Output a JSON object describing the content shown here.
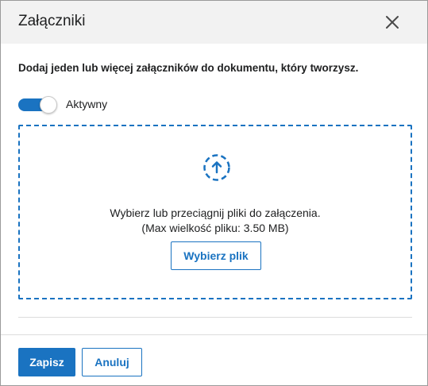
{
  "dialog": {
    "title": "Załączniki",
    "description": "Dodaj jeden lub więcej załączników do dokumentu, który tworzysz.",
    "toggle": {
      "label": "Aktywny",
      "on": true
    },
    "dropzone": {
      "line1": "Wybierz lub przeciągnij pliki do załączenia.",
      "line2": "(Max wielkość pliku: 3.50 MB)",
      "choose_label": "Wybierz plik"
    },
    "footer": {
      "save_label": "Zapisz",
      "cancel_label": "Anuluj"
    }
  },
  "colors": {
    "accent": "#1a73c1",
    "header_bg": "#f2f2f2"
  },
  "icons": {
    "close": "close-icon",
    "upload": "upload-arrow-icon"
  }
}
